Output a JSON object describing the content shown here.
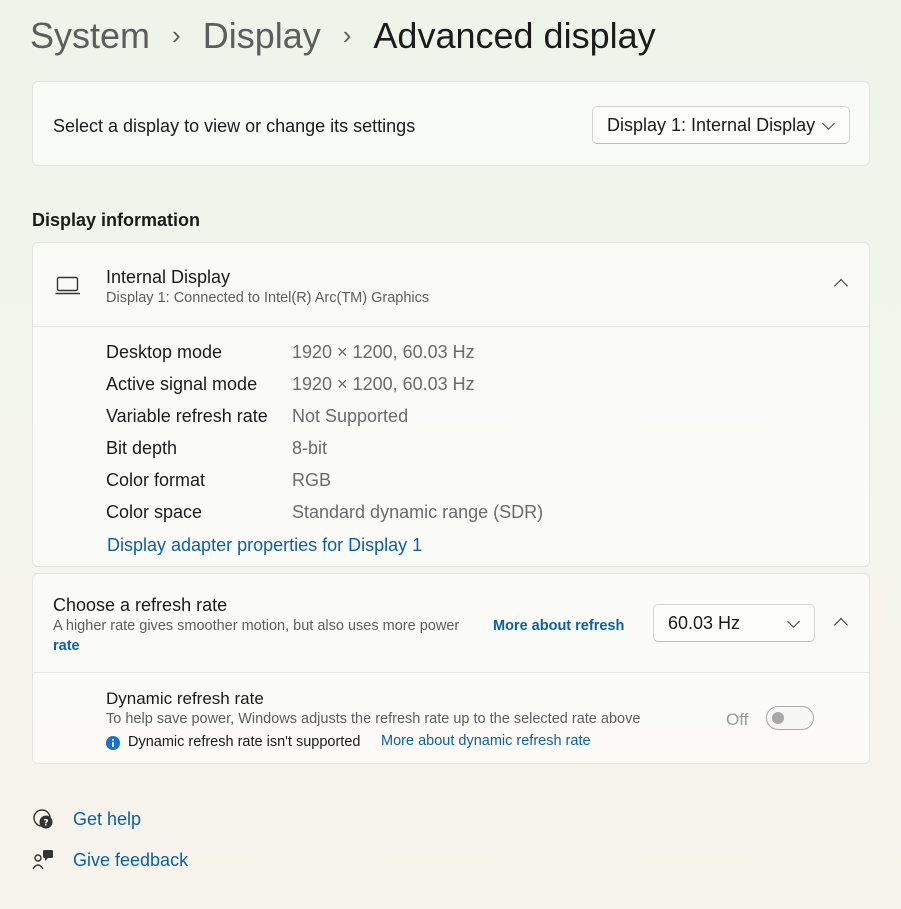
{
  "breadcrumb": {
    "items": [
      "System",
      "Display"
    ],
    "current": "Advanced display",
    "separator": "›"
  },
  "display_select": {
    "label": "Select a display to view or change its settings",
    "value": "Display 1: Internal Display"
  },
  "section_title": "Display information",
  "display_info": {
    "name": "Internal Display",
    "subtitle": "Display 1: Connected to Intel(R) Arc(TM) Graphics",
    "rows": [
      {
        "label": "Desktop mode",
        "value": "1920 × 1200, 60.03 Hz"
      },
      {
        "label": "Active signal mode",
        "value": "1920 × 1200, 60.03 Hz"
      },
      {
        "label": "Variable refresh rate",
        "value": "Not Supported"
      },
      {
        "label": "Bit depth",
        "value": "8-bit"
      },
      {
        "label": "Color format",
        "value": "RGB"
      },
      {
        "label": "Color space",
        "value": "Standard dynamic range (SDR)"
      }
    ],
    "adapter_link": "Display adapter properties for Display 1"
  },
  "refresh": {
    "title": "Choose a refresh rate",
    "description": "A higher rate gives smoother motion, but also uses more power",
    "more_link_line1": "More about refresh",
    "more_link_line2": "rate",
    "value": "60.03 Hz"
  },
  "dynamic": {
    "title": "Dynamic refresh rate",
    "description": "To help save power, Windows adjusts the refresh rate up to the selected rate above",
    "toggle_state": "Off",
    "notice": "Dynamic refresh rate isn't supported",
    "link": "More about dynamic refresh rate"
  },
  "footer": {
    "help": "Get help",
    "feedback": "Give feedback"
  },
  "colors": {
    "link": "#0b5fab",
    "info_icon": "#1a6fd0"
  },
  "icons": [
    "chevron-right-icon",
    "chevron-down-icon",
    "chevron-up-icon",
    "laptop-icon",
    "info-icon",
    "help-icon",
    "feedback-icon"
  ]
}
